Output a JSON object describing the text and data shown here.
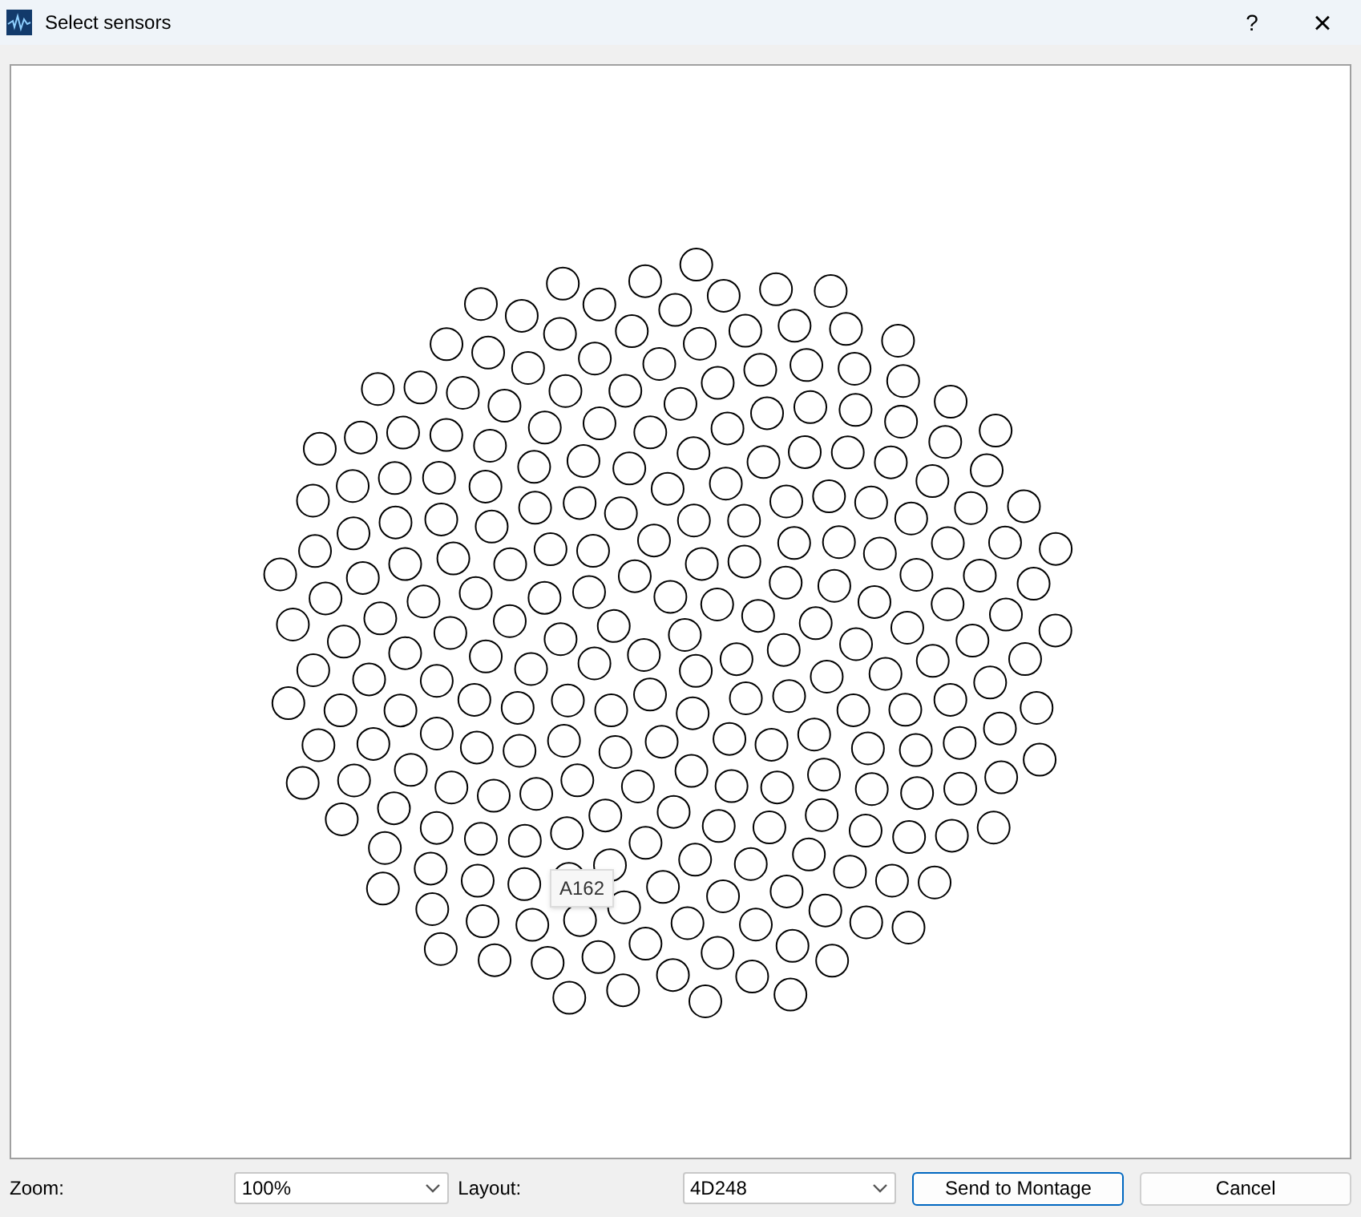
{
  "window": {
    "title": "Select sensors"
  },
  "title_buttons": [
    "?",
    "×"
  ],
  "sensor_tooltip": "A162",
  "zoom": {
    "label": "Zoom:",
    "value": "100%"
  },
  "layout": {
    "label": "Layout:",
    "value": "4D248"
  },
  "buttons": [
    {
      "label": "Send to Montage",
      "selected": true
    },
    {
      "label": "Cancel",
      "selected": false
    }
  ]
}
